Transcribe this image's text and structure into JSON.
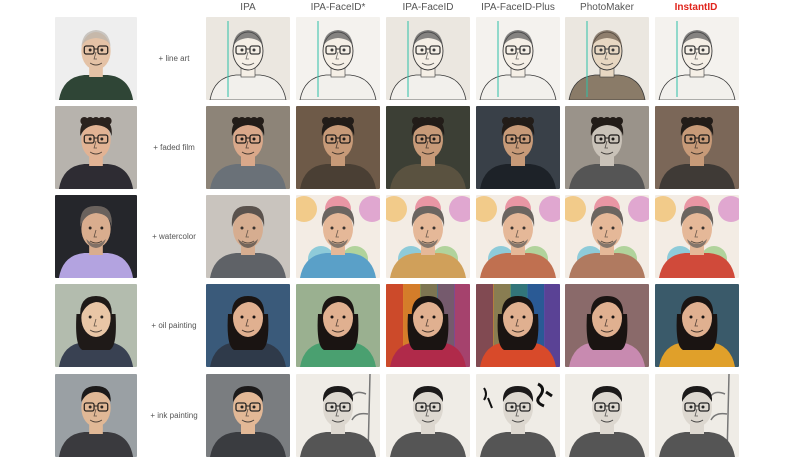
{
  "columns": [
    "IPA",
    "IPA-FaceID*",
    "IPA-FaceID",
    "IPA-FaceID-Plus",
    "PhotoMaker",
    "InstantID"
  ],
  "highlight_color": "#e0241b",
  "rows": [
    {
      "prompt": "+ line art",
      "style": "line",
      "subject": "bald",
      "skin": "#e4c2a6",
      "hair": "#b9b3ad",
      "shirt": "#2f4536",
      "bg": "#eeeeee",
      "glasses": true
    },
    {
      "prompt": "+ faded film",
      "style": "film",
      "subject": "curly",
      "skin": "#e2b394",
      "hair": "#2a221e",
      "shirt": "#2e2c33",
      "bg": "#b7b3ad",
      "glasses": true
    },
    {
      "prompt": "+ watercolor",
      "style": "watercolor",
      "subject": "gray",
      "skin": "#d9ad8e",
      "hair": "#6a625d",
      "shirt": "#b3a3e0",
      "bg": "#25262b",
      "glasses": false
    },
    {
      "prompt": "+ oil painting",
      "style": "oil",
      "subject": "woman",
      "skin": "#e9c6a6",
      "hair": "#1f1a18",
      "shirt": "#394152",
      "bg": "#b3bcae",
      "glasses": false
    },
    {
      "prompt": "+ ink painting",
      "style": "ink",
      "subject": "glasses",
      "skin": "#e0b896",
      "hair": "#1c1a1a",
      "shirt": "#3a3a3e",
      "bg": "#9aa0a4",
      "glasses": true
    }
  ]
}
